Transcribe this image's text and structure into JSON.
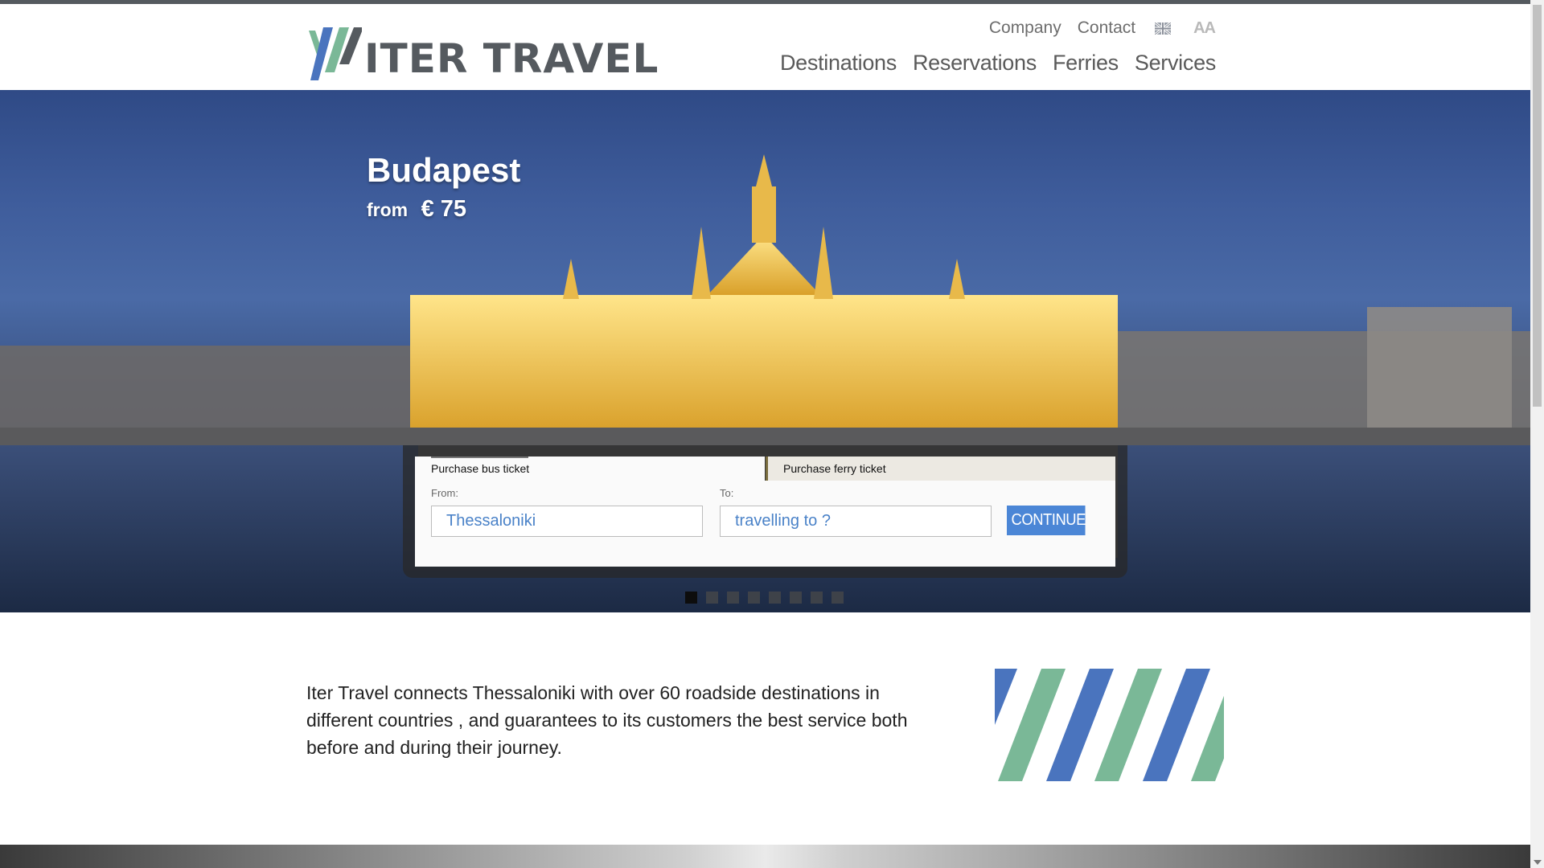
{
  "header": {
    "logo_text": "ITER TRAVEL",
    "util_links": [
      "Company",
      "Contact"
    ],
    "language_icon": "uk-flag-icon",
    "font_size_icon_label": "AA",
    "nav": [
      "Destinations",
      "Reservations",
      "Ferries",
      "Services"
    ]
  },
  "hero": {
    "title": "Budapest",
    "from_label": "from",
    "price": "€ 75"
  },
  "booking": {
    "tab_bus": "Purchase bus ticket",
    "tab_ferry": "Purchase ferry ticket",
    "from_label": "From:",
    "from_value": "Thessaloniki",
    "to_label": "To:",
    "to_placeholder": "travelling to ?",
    "continue_label": "CONTINUE"
  },
  "carousel": {
    "slide_count": 8,
    "active_index": 1
  },
  "intro": {
    "text": "Iter Travel connects Thessaloniki with over 60 roadside destinations in different countries , and guarantees to its customers the best service both before and during their journey."
  },
  "colors": {
    "brand_gray": "#555a5f",
    "brand_green": "#7ab897",
    "brand_blue": "#4a74be",
    "button_blue": "#4b86d6"
  }
}
